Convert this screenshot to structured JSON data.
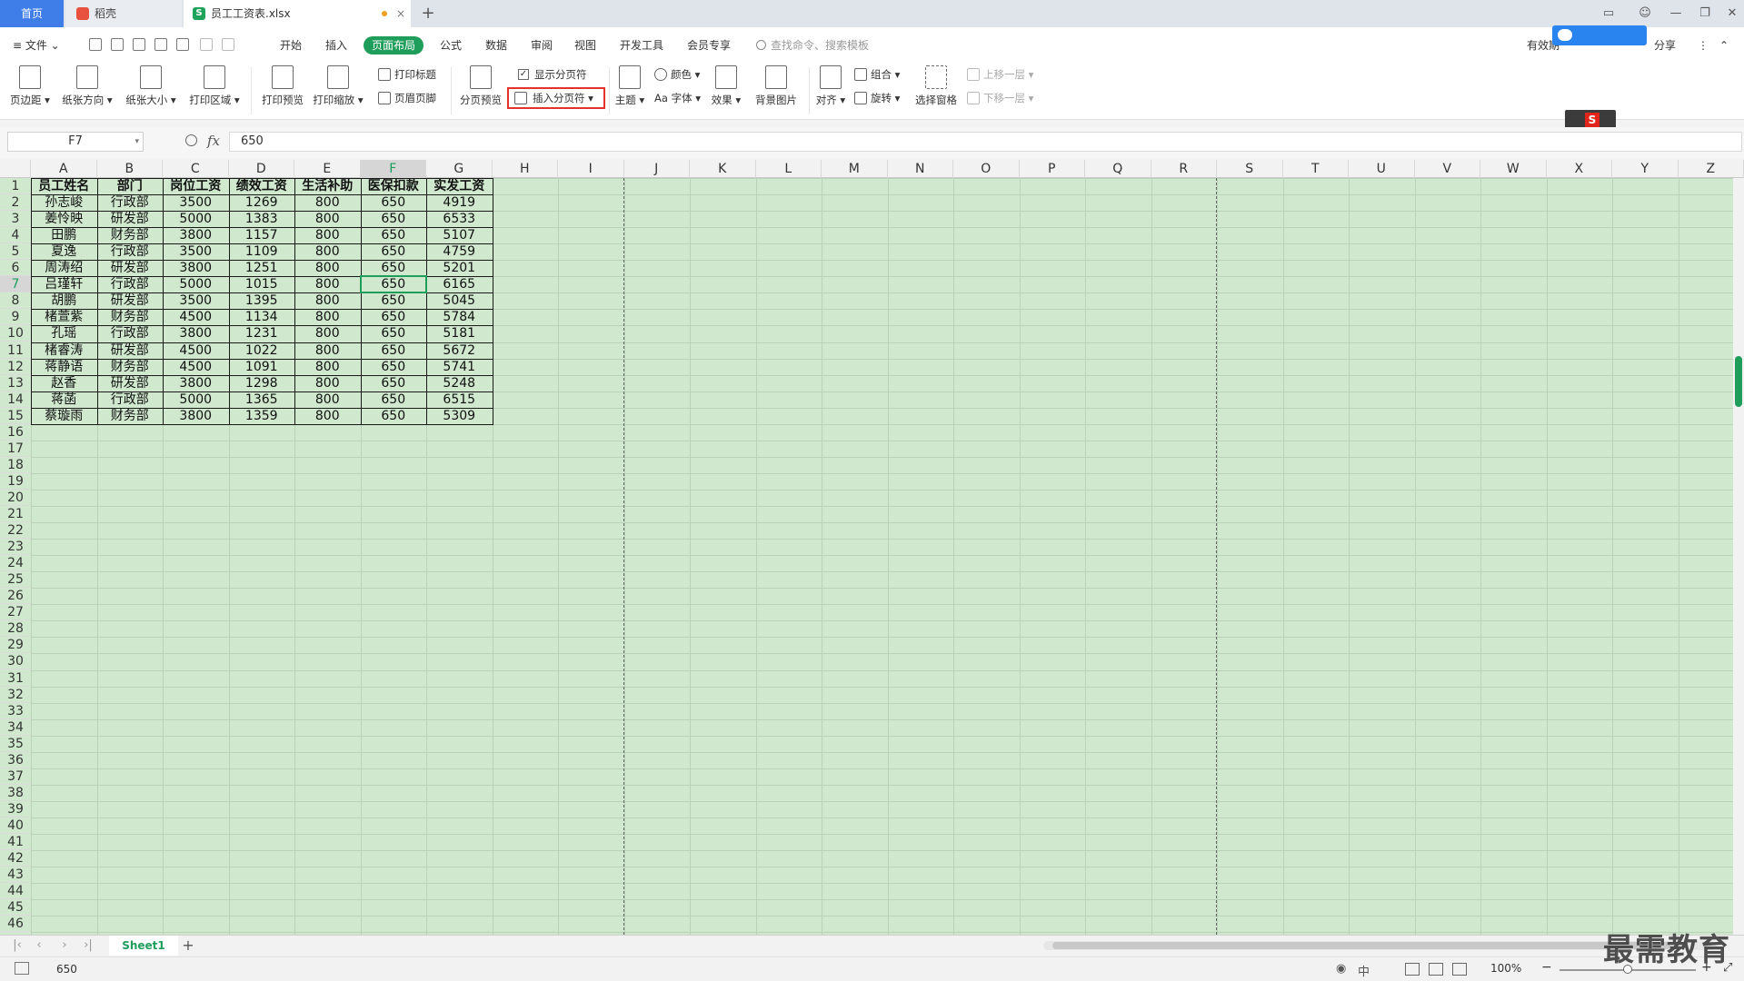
{
  "tabs": {
    "home": "首页",
    "daoke": "稻壳",
    "doc": "员工工资表.xlsx",
    "add": "+"
  },
  "menu": {
    "file": "≡ 文件 ⌄",
    "start": "开始",
    "insert": "插入",
    "page_layout": "页面布局",
    "formula": "公式",
    "data": "数据",
    "review": "审阅",
    "view": "视图",
    "devtools": "开发工具",
    "member": "会员专享",
    "search_placeholder": "查找命令、搜索模板",
    "cloud": "有效期",
    "share": "分享"
  },
  "ribbon": {
    "margins": "页边距 ▾",
    "orientation": "纸张方向 ▾",
    "size": "纸张大小 ▾",
    "print_area": "打印区域 ▾",
    "print_preview": "打印预览",
    "print_scale": "打印缩放 ▾",
    "print_titles": "打印标题",
    "header_footer": "页眉页脚",
    "break_preview": "分页预览",
    "show_breaks": "显示分页符",
    "insert_break": "插入分页符 ▾",
    "theme": "主题 ▾",
    "colors": "颜色 ▾",
    "fonts": "Aa 字体 ▾",
    "effects": "效果 ▾",
    "background": "背景图片",
    "align": "对齐 ▾",
    "group": "组合 ▾",
    "rotate": "旋转 ▾",
    "selection_pane": "选择窗格",
    "bring_forward": "上移一层 ▾",
    "send_backward": "下移一层 ▾"
  },
  "formula_bar": {
    "name_box": "F7",
    "fx": "fx",
    "value": "650"
  },
  "columns": [
    "A",
    "B",
    "C",
    "D",
    "E",
    "F",
    "G",
    "H",
    "I",
    "J",
    "K",
    "L",
    "M",
    "N",
    "O",
    "P",
    "Q",
    "R",
    "S",
    "T",
    "U",
    "V",
    "W",
    "X",
    "Y",
    "Z"
  ],
  "selected_column": "F",
  "selected_row": 7,
  "table": {
    "headers": [
      "员工姓名",
      "部门",
      "岗位工资",
      "绩效工资",
      "生活补助",
      "医保扣款",
      "实发工资"
    ],
    "rows": [
      [
        "孙志峻",
        "行政部",
        "3500",
        "1269",
        "800",
        "650",
        "4919"
      ],
      [
        "姜怜映",
        "研发部",
        "5000",
        "1383",
        "800",
        "650",
        "6533"
      ],
      [
        "田鹏",
        "财务部",
        "3800",
        "1157",
        "800",
        "650",
        "5107"
      ],
      [
        "夏逸",
        "行政部",
        "3500",
        "1109",
        "800",
        "650",
        "4759"
      ],
      [
        "周涛绍",
        "研发部",
        "3800",
        "1251",
        "800",
        "650",
        "5201"
      ],
      [
        "吕瑾轩",
        "行政部",
        "5000",
        "1015",
        "800",
        "650",
        "6165"
      ],
      [
        "胡鹏",
        "研发部",
        "3500",
        "1395",
        "800",
        "650",
        "5045"
      ],
      [
        "楮萱紫",
        "财务部",
        "4500",
        "1134",
        "800",
        "650",
        "5784"
      ],
      [
        "孔瑶",
        "行政部",
        "3800",
        "1231",
        "800",
        "650",
        "5181"
      ],
      [
        "楮睿涛",
        "研发部",
        "4500",
        "1022",
        "800",
        "650",
        "5672"
      ],
      [
        "蒋静语",
        "财务部",
        "4500",
        "1091",
        "800",
        "650",
        "5741"
      ],
      [
        "赵香",
        "研发部",
        "3800",
        "1298",
        "800",
        "650",
        "5248"
      ],
      [
        "蒋菡",
        "行政部",
        "5000",
        "1365",
        "800",
        "650",
        "6515"
      ],
      [
        "蔡璇雨",
        "财务部",
        "3800",
        "1359",
        "800",
        "650",
        "5309"
      ]
    ]
  },
  "sheet": {
    "name": "Sheet1",
    "add": "+"
  },
  "status": {
    "value": "650",
    "zoom": "100%"
  },
  "watermark": "最需教育",
  "colors": {
    "accent": "#1e9e5a",
    "grid_bg": "#cfe8ce",
    "highlight_box": "#e5312e",
    "tab_active": "#3f7ee8"
  }
}
